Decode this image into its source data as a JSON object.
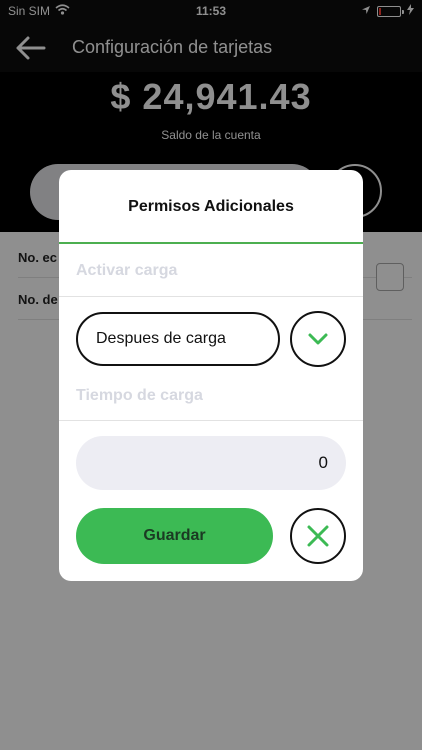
{
  "status_bar": {
    "carrier": "Sin SIM",
    "time": "11:53"
  },
  "nav": {
    "title": "Configuración de tarjetas"
  },
  "account": {
    "balance": "$ 24,941.43",
    "balance_label": "Saldo de la cuenta"
  },
  "content": {
    "rows": [
      "No. ec",
      "No. de"
    ]
  },
  "modal": {
    "title": "Permisos Adicionales",
    "activate_label": "Activar carga",
    "select_value": "Despues de carga",
    "time_label": "Tiempo de carga",
    "time_value": "0",
    "save_label": "Guardar"
  },
  "colors": {
    "accent_green": "#3cba54",
    "header_black": "#0d0d0d",
    "placeholder_gray": "#d6d8e0"
  },
  "icons": {
    "back": "arrow-left",
    "dropdown": "chevron-down",
    "cancel": "close-x"
  }
}
